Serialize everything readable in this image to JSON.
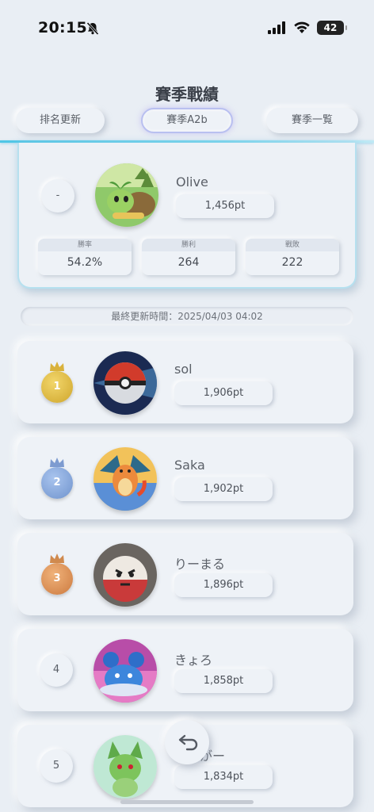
{
  "status_bar": {
    "time": "20:15",
    "battery": "42"
  },
  "header": {
    "title": "賽季戰績",
    "buttons": [
      "排名更新",
      "賽季A2b",
      "賽季一覧"
    ]
  },
  "my_card": {
    "rank": "-",
    "name": "Olive",
    "points": "1,456pt",
    "stats": [
      {
        "label": "勝率",
        "value": "54.2%"
      },
      {
        "label": "勝利",
        "value": "264"
      },
      {
        "label": "戰敗",
        "value": "222"
      }
    ]
  },
  "last_updated": "最終更新時間：2025/04/03 04:02",
  "leaderboard": [
    {
      "rank": "1",
      "name": "sol",
      "points": "1,906pt",
      "medal": "gold"
    },
    {
      "rank": "2",
      "name": "Saka",
      "points": "1,902pt",
      "medal": "silver"
    },
    {
      "rank": "3",
      "name": "りーまる",
      "points": "1,896pt",
      "medal": "bronze"
    },
    {
      "rank": "4",
      "name": "きょろ",
      "points": "1,858pt"
    },
    {
      "rank": "5",
      "name": "まいがー",
      "points": "1,834pt"
    }
  ],
  "icons": {
    "back": "return-arrow-icon",
    "bell": "bell-slash-icon"
  }
}
